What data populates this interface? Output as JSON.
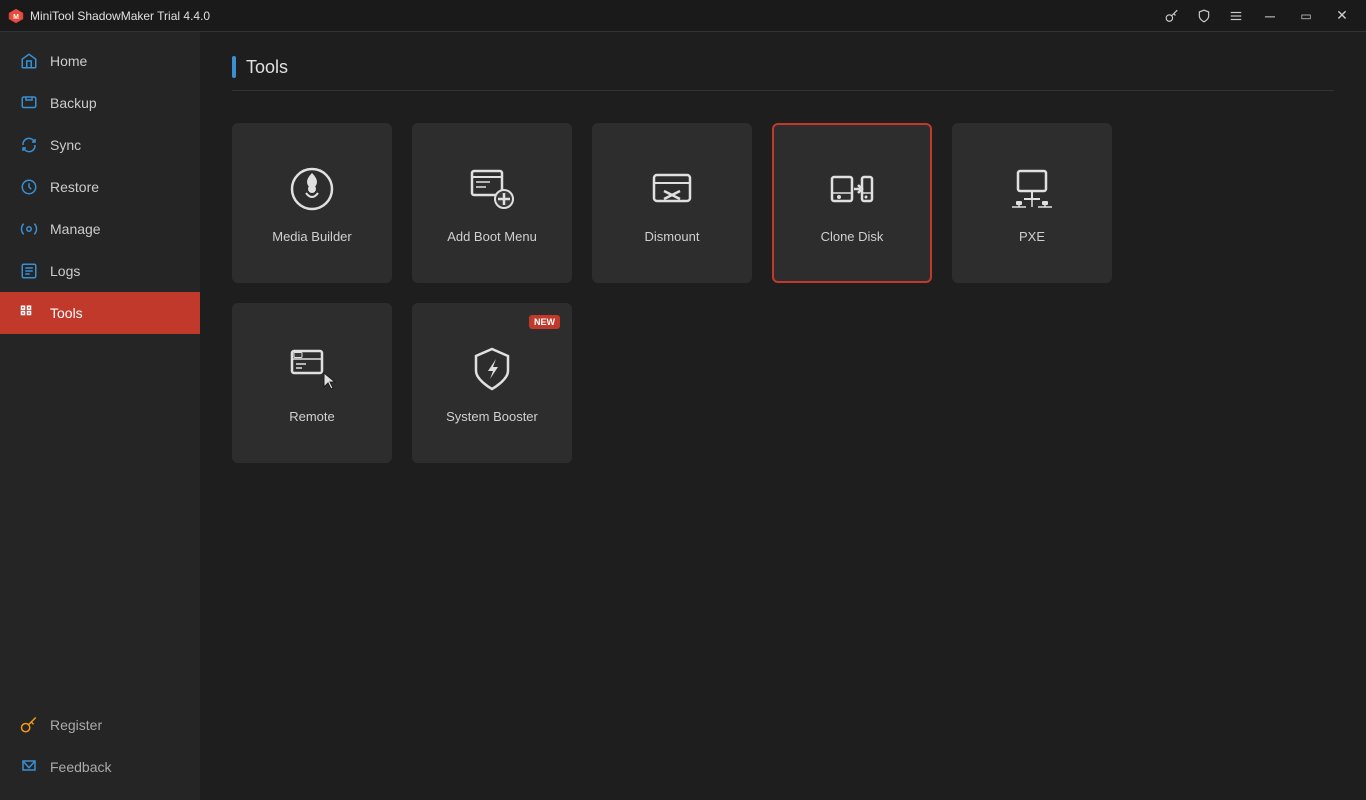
{
  "titlebar": {
    "title": "MiniTool ShadowMaker Trial 4.4.0"
  },
  "sidebar": {
    "items": [
      {
        "id": "home",
        "label": "Home",
        "active": false
      },
      {
        "id": "backup",
        "label": "Backup",
        "active": false
      },
      {
        "id": "sync",
        "label": "Sync",
        "active": false
      },
      {
        "id": "restore",
        "label": "Restore",
        "active": false
      },
      {
        "id": "manage",
        "label": "Manage",
        "active": false
      },
      {
        "id": "logs",
        "label": "Logs",
        "active": false
      },
      {
        "id": "tools",
        "label": "Tools",
        "active": true
      }
    ],
    "bottom_items": [
      {
        "id": "register",
        "label": "Register"
      },
      {
        "id": "feedback",
        "label": "Feedback"
      }
    ]
  },
  "content": {
    "page_title": "Tools",
    "tools": [
      {
        "id": "media-builder",
        "label": "Media Builder",
        "icon": "media",
        "selected": false,
        "new": false
      },
      {
        "id": "add-boot-menu",
        "label": "Add Boot Menu",
        "icon": "boot",
        "selected": false,
        "new": false
      },
      {
        "id": "dismount",
        "label": "Dismount",
        "icon": "dismount",
        "selected": false,
        "new": false
      },
      {
        "id": "clone-disk",
        "label": "Clone Disk",
        "icon": "clone",
        "selected": true,
        "new": false
      },
      {
        "id": "pxe",
        "label": "PXE",
        "icon": "pxe",
        "selected": false,
        "new": false
      },
      {
        "id": "remote",
        "label": "Remote",
        "icon": "remote",
        "selected": false,
        "new": false
      },
      {
        "id": "system-booster",
        "label": "System Booster",
        "icon": "booster",
        "selected": false,
        "new": true
      }
    ]
  }
}
